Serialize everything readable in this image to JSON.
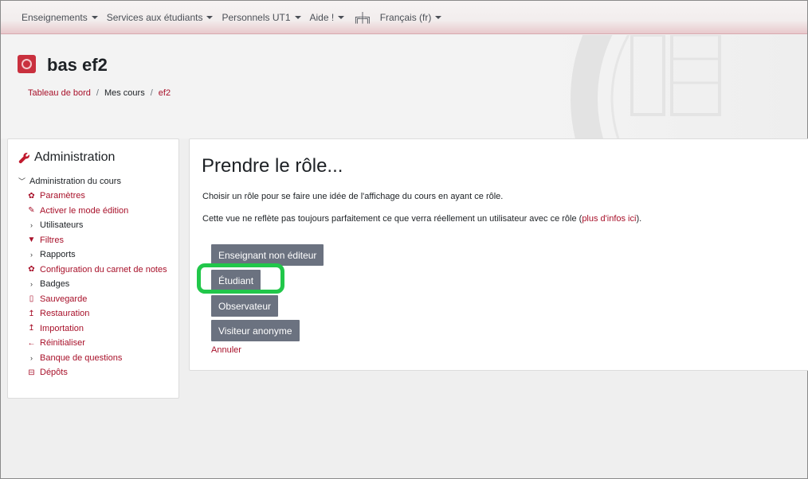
{
  "navbar": {
    "items": [
      {
        "label": "Enseignements",
        "caret": true
      },
      {
        "label": "Services aux étudiants",
        "caret": true
      },
      {
        "label": "Personnels UT1",
        "caret": true
      },
      {
        "label": "Aide !",
        "caret": true
      }
    ],
    "mode_icon_glyph": "╔╪╗",
    "language": "Français (fr)"
  },
  "header": {
    "course_title": "bas ef2",
    "breadcrumb": [
      {
        "label": "Tableau de bord",
        "link": true
      },
      {
        "label": "Mes cours",
        "link": false
      },
      {
        "label": "ef2",
        "link": true
      }
    ],
    "separator": "/"
  },
  "admin": {
    "title": "Administration",
    "root": "Administration du cours",
    "items": [
      {
        "label": "Paramètres",
        "icon": "gear-icon",
        "glyph": "✿",
        "link": true
      },
      {
        "label": "Activer le mode édition",
        "icon": "pencil-icon",
        "glyph": "✎",
        "link": true
      },
      {
        "label": "Utilisateurs",
        "icon": "chevron-right-icon",
        "glyph": "›",
        "link": false
      },
      {
        "label": "Filtres",
        "icon": "filter-icon",
        "glyph": "▼",
        "link": true
      },
      {
        "label": "Rapports",
        "icon": "chevron-right-icon",
        "glyph": "›",
        "link": false
      },
      {
        "label": "Configuration du carnet de notes",
        "icon": "gear-icon",
        "glyph": "✿",
        "link": true
      },
      {
        "label": "Badges",
        "icon": "chevron-right-icon",
        "glyph": "›",
        "link": false
      },
      {
        "label": "Sauvegarde",
        "icon": "file-icon",
        "glyph": "▯",
        "link": true
      },
      {
        "label": "Restauration",
        "icon": "upload-icon",
        "glyph": "↥",
        "link": true
      },
      {
        "label": "Importation",
        "icon": "upload-icon",
        "glyph": "↥",
        "link": true
      },
      {
        "label": "Réinitialiser",
        "icon": "arrow-left-icon",
        "glyph": "←",
        "link": true
      },
      {
        "label": "Banque de questions",
        "icon": "chevron-right-icon",
        "glyph": "›",
        "link": false
      },
      {
        "label": "Dépôts",
        "icon": "drive-icon",
        "glyph": "⊟",
        "link": true
      }
    ]
  },
  "main": {
    "heading": "Prendre le rôle...",
    "desc1": "Choisir un rôle pour se faire une idée de l'affichage du cours en ayant ce rôle.",
    "desc2_prefix": "Cette vue ne reflète pas toujours parfaitement ce que verra réellement un utilisateur avec ce rôle (",
    "desc2_link": "plus d'infos ici",
    "desc2_suffix": ").",
    "roles": [
      "Enseignant non éditeur",
      "Étudiant",
      "Observateur",
      "Visiteur anonyme"
    ],
    "cancel": "Annuler",
    "highlight_color": "#21c74a",
    "accent_color": "#a8112a"
  }
}
